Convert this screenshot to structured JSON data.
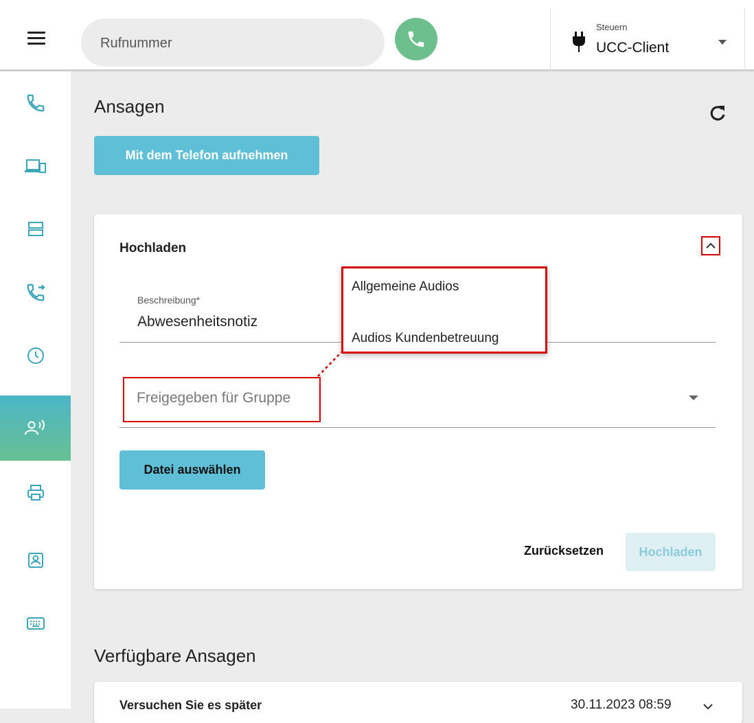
{
  "topbar": {
    "search_placeholder": "Rufnummer",
    "control_label_small": "Steuern",
    "control_value": "UCC-Client"
  },
  "sidebar": {
    "items": [
      {
        "icon": "phone-icon"
      },
      {
        "icon": "devices-icon"
      },
      {
        "icon": "server-icon"
      },
      {
        "icon": "call-forward-icon"
      },
      {
        "icon": "clock-icon"
      },
      {
        "icon": "announcement-icon",
        "active": true
      },
      {
        "icon": "printer-icon"
      },
      {
        "icon": "contact-icon"
      },
      {
        "icon": "keyboard-icon"
      }
    ],
    "accent": "#4bb6c7"
  },
  "main": {
    "title": "Ansagen",
    "record_button": "Mit dem Telefon aufnehmen",
    "upload_card": {
      "title": "Hochladen",
      "description_label": "Beschreibung*",
      "description_value": "Abwesenheitsnotiz",
      "group_placeholder": "Freigegeben für Gruppe",
      "select_file_button": "Datei auswählen",
      "reset_button": "Zurücksetzen",
      "upload_button": "Hochladen"
    },
    "group_dropdown": {
      "options": [
        "Allgemeine Audios",
        "Audios Kundenbetreuung"
      ]
    },
    "available_title": "Verfügbare Ansagen",
    "available_list": [
      {
        "title": "Versuchen Sie es später",
        "date": "30.11.2023 08:59"
      }
    ]
  },
  "colors": {
    "call_green": "#6dbf8e",
    "button_blue": "#5fbfd6",
    "highlight_red": "#d40000",
    "icon_teal": "#3aa6b9"
  }
}
